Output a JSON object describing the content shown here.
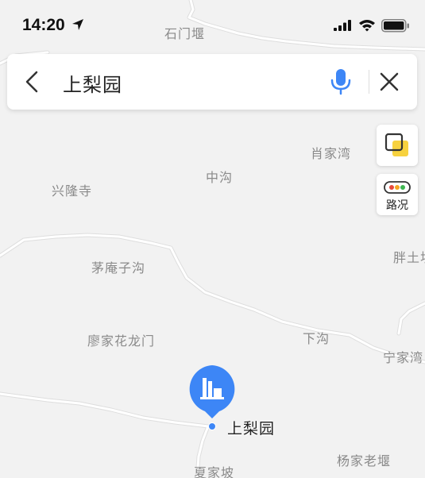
{
  "status_bar": {
    "time": "14:20"
  },
  "search": {
    "query": "上梨园"
  },
  "map_labels": {
    "shimenyan": "石门堰",
    "xiaojiawan": "肖家湾",
    "zhonggou": "中沟",
    "xinglongsi": "兴隆寺",
    "maoanzigou": "茅庵子沟",
    "pangtu": "胖土坝",
    "liaojiahualongmen": "廖家花龙门",
    "xiagou": "下沟",
    "ningjiawan": "宁家湾",
    "xiajiapo": "夏家坡",
    "yangjialaoyan": "杨家老堰"
  },
  "controls": {
    "traffic_label": "路况"
  },
  "poi": {
    "name": "上梨园"
  },
  "colors": {
    "map_background": "#f2f2f2",
    "road": "#ffffff",
    "road_edge": "#dedede",
    "poi_blue": "#3d86f6",
    "mic_blue": "#3d86f6",
    "layer_yellow": "#f7d23f"
  }
}
